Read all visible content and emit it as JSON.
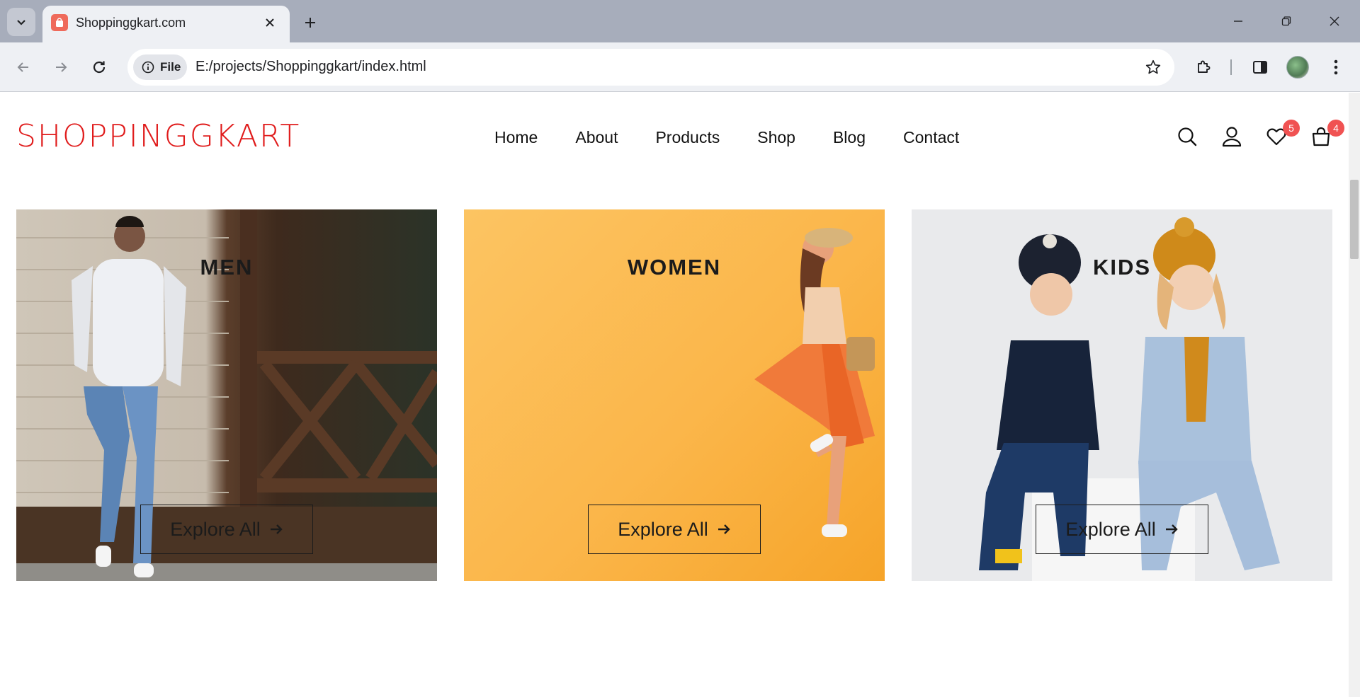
{
  "browser": {
    "tab_title": "Shoppinggkart.com",
    "url_chip": "File",
    "url": "E:/projects/Shoppinggkart/index.html"
  },
  "site": {
    "logo": "SHOPPINGGKART",
    "nav": [
      "Home",
      "About",
      "Products",
      "Shop",
      "Blog",
      "Contact"
    ],
    "wishlist_count": "5",
    "cart_count": "4",
    "accent_color": "#e01b1b"
  },
  "categories": [
    {
      "title": "MEN",
      "button": "Explore All"
    },
    {
      "title": "WOMEN",
      "button": "Explore All"
    },
    {
      "title": "KIDS",
      "button": "Explore All"
    }
  ]
}
